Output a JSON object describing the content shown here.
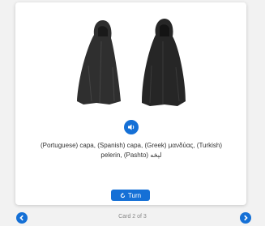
{
  "card": {
    "image_alt": "two black hooded capes",
    "caption": "(Portuguese) capa, (Spanish) capa, (Greek) μανδύας, (Turkish) pelerin, (Pashto) لېڅه",
    "turn_label": "Turn"
  },
  "footer": {
    "counter": "Card 2 of 3"
  },
  "colors": {
    "accent": "#1570d6",
    "cape": "#2b2b2b"
  }
}
